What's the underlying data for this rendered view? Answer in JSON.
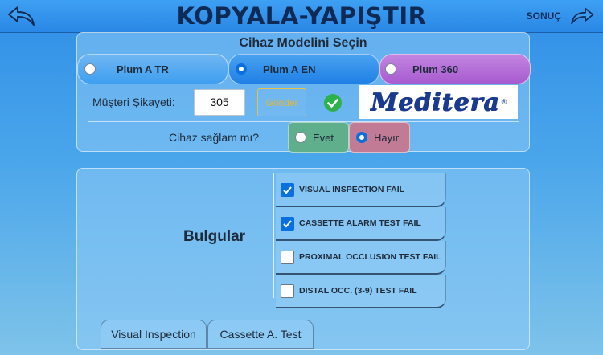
{
  "header": {
    "title": "KOPYALA-YAPIŞTIR",
    "next_label": "SONUÇ",
    "back_icon": "undo-arrow-icon",
    "next_icon": "redo-arrow-icon"
  },
  "model_panel": {
    "title": "Cihaz Modelini Seçin",
    "models": [
      {
        "label": "Plum A TR",
        "selected": false,
        "color": "#3f9ff0"
      },
      {
        "label": "Plum A EN",
        "selected": true,
        "color": "#1f80e5"
      },
      {
        "label": "Plum 360",
        "selected": false,
        "color": "#b067d2"
      }
    ],
    "complaint_label": "Müşteri Şikayeti:",
    "complaint_value": "305",
    "send_label": "Gönder",
    "send_color": "#e2b63a",
    "status_icon": "green-check-icon",
    "logo_text": "Meditera",
    "logo_reg": "®",
    "healthy_question": "Cihaz sağlam mı?",
    "yes_label": "Evet",
    "no_label": "Hayır",
    "healthy_selected": "Hayır",
    "yes_color": "#5fae8c",
    "no_color": "#c27b95"
  },
  "findings_panel": {
    "title": "Bulgular",
    "items": [
      {
        "label": "VISUAL INSPECTION FAIL",
        "checked": true
      },
      {
        "label": "CASSETTE ALARM TEST FAIL",
        "checked": true
      },
      {
        "label": "PROXIMAL OCCLUSION TEST FAIL",
        "checked": false
      },
      {
        "label": "DISTAL OCC. (3-9) TEST FAIL",
        "checked": false
      }
    ],
    "tabs": [
      {
        "label": "Visual Inspection"
      },
      {
        "label": "Cassette A. Test"
      }
    ]
  }
}
